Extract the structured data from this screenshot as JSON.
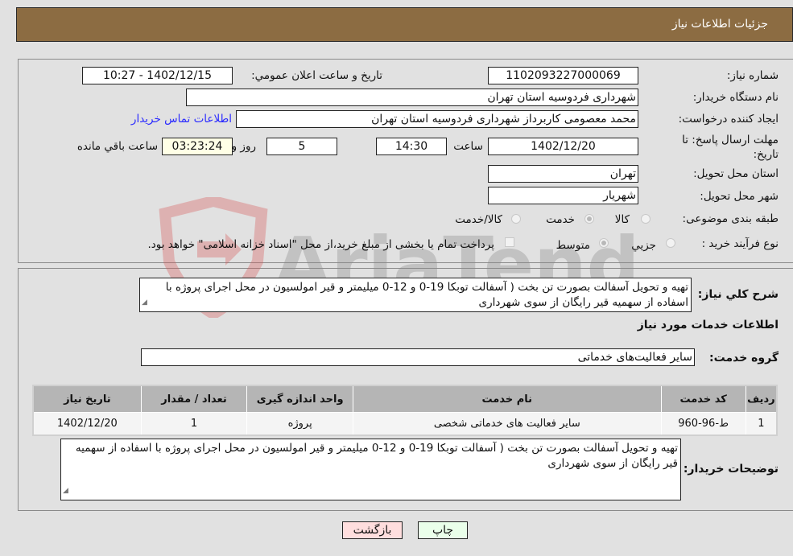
{
  "header": {
    "title": "جزئیات اطلاعات نیاز"
  },
  "fields": {
    "need_number": {
      "label": "شماره نیاز:",
      "value": "1102093227000069"
    },
    "announce_datetime": {
      "label": "تاریخ و ساعت اعلان عمومي:",
      "value": "1402/12/15 - 10:27"
    },
    "buyer_org": {
      "label": "نام دستگاه خریدار:",
      "value": "شهرداری فردوسیه استان تهران"
    },
    "requester": {
      "label": "ایجاد کننده درخواست:",
      "value": "محمد معصومی کاربرداز شهرداری فردوسیه استان تهران"
    },
    "contact_link": "اطلاعات تماس خریدار",
    "deadline": {
      "label": "مهلت ارسال پاسخ: تا تاریخ:",
      "date": "1402/12/20",
      "time_label": "ساعت",
      "time": "14:30",
      "days": "5",
      "days_label": "روز و",
      "remaining": "03:23:24",
      "remaining_label": "ساعت باقي مانده"
    },
    "province": {
      "label": "استان محل تحویل:",
      "value": "تهران"
    },
    "city": {
      "label": "شهر محل تحویل:",
      "value": "شهریار"
    },
    "category": {
      "label": "طبقه بندی موضوعی:",
      "options": [
        {
          "label": "کالا",
          "selected": false
        },
        {
          "label": "خدمت",
          "selected": true
        },
        {
          "label": "کالا/خدمت",
          "selected": false
        }
      ]
    },
    "purchase_type": {
      "label": "نوع فرآیند خرید :",
      "options": [
        {
          "label": "جزيي",
          "selected": false
        },
        {
          "label": "متوسط",
          "selected": true
        }
      ],
      "treasury_checkbox_label": "پرداخت تمام یا بخشی از مبلغ خرید،از محل \"اسناد خزانه اسلامی\" خواهد بود.",
      "treasury_checked": false
    }
  },
  "description": {
    "label": "شرح كلي نياز:",
    "value": "تهیه و تحویل آسفالت بصورت تن بخت ( آسفالت توبکا 19-0 و 12-0 میلیمتر و قیر امولسیون در محل اجرای پروژه با اسفاده از سهمیه قیر رایگان از سوی شهرداری"
  },
  "services_section": {
    "title": "اطلاعات خدمات مورد نیاز",
    "group_label": "گروه خدمت:",
    "group_value": "سایر فعالیت‌های خدماتی",
    "table": {
      "headers": [
        "ردیف",
        "کد خدمت",
        "نام خدمت",
        "واحد اندازه گیری",
        "تعداد / مقدار",
        "تاریخ نیاز"
      ],
      "rows": [
        [
          "1",
          "ط-96-960",
          "سایر فعالیت های خدماتی شخصی",
          "پروژه",
          "1",
          "1402/12/20"
        ]
      ]
    }
  },
  "buyer_notes": {
    "label": "توضیحات خریدار:",
    "value": "تهیه و تحویل آسفالت بصورت تن بخت ( آسفالت توبکا 19-0 و 12-0 میلیمتر و قیر امولسیون در محل اجرای پروژه با اسفاده از سهمیه قیر رایگان از سوی شهرداری"
  },
  "buttons": {
    "print": "چاپ",
    "back": "بازگشت"
  },
  "watermark": "AriaTender.neT",
  "colors": {
    "header_bg": "#8c6c42",
    "print_btn": "#eaffea",
    "back_btn": "#ffdede",
    "link": "#2a2aff"
  }
}
